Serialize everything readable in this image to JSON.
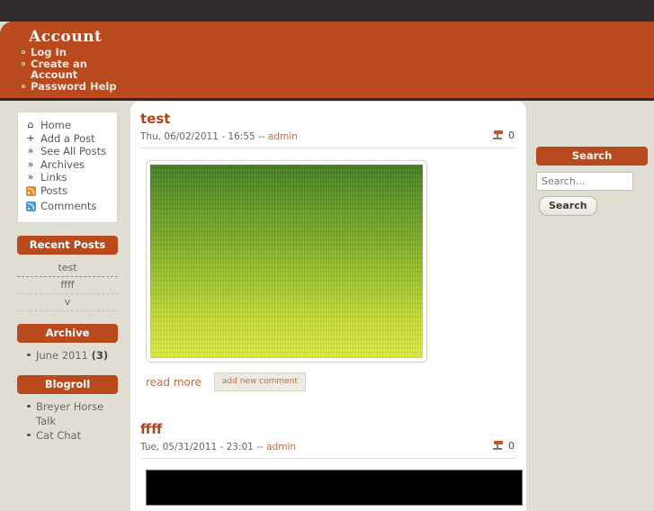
{
  "header": {
    "site_title": "Account",
    "account_links": [
      {
        "label": "Log In"
      },
      {
        "label": "Create an Account"
      },
      {
        "label": "Password Help"
      }
    ]
  },
  "sidebar_left": {
    "nav": [
      {
        "icon": "home-icon",
        "glyph": "⌂",
        "label": "Home"
      },
      {
        "icon": "plus-icon",
        "glyph": "+",
        "label": "Add a Post"
      },
      {
        "icon": "chevron-right-icon",
        "glyph": "»",
        "label": "See All Posts"
      },
      {
        "icon": "chevron-right-icon",
        "glyph": "»",
        "label": "Archives"
      },
      {
        "icon": "chevron-right-icon",
        "glyph": "»",
        "label": "Links"
      },
      {
        "icon": "rss-icon-orange",
        "glyph": "",
        "label": "Posts"
      },
      {
        "icon": "rss-icon-blue",
        "glyph": "",
        "label": "Comments"
      }
    ],
    "recent_posts": {
      "title": "Recent Posts",
      "items": [
        {
          "label": "test"
        },
        {
          "label": "ffff"
        },
        {
          "label": "v"
        }
      ]
    },
    "archive": {
      "title": "Archive",
      "items": [
        {
          "label": "June 2011",
          "count": "(3)"
        }
      ]
    },
    "blogroll": {
      "title": "Blogroll",
      "items": [
        {
          "label": "Breyer Horse Talk"
        },
        {
          "label": "Cat Chat"
        }
      ]
    }
  },
  "sidebar_right": {
    "search": {
      "title": "Search",
      "placeholder": "Search...",
      "value": "",
      "button_label": "Search"
    }
  },
  "main": {
    "posts": [
      {
        "title": "test",
        "meta": "Thu, 06/02/2011 - 16:55 --",
        "author": "admin",
        "comment_count": "0",
        "read_more": "read more",
        "add_comment": "add new comment"
      },
      {
        "title": "ffff",
        "meta": "Tue, 05/31/2011 - 23:01 --",
        "author": "admin",
        "comment_count": "0"
      }
    ]
  },
  "colors": {
    "accent": "#b94a1e",
    "dark_bar": "#2e2b2a",
    "page_bg": "#e0ded3",
    "link": "#c8693a",
    "title": "#b4431b"
  }
}
